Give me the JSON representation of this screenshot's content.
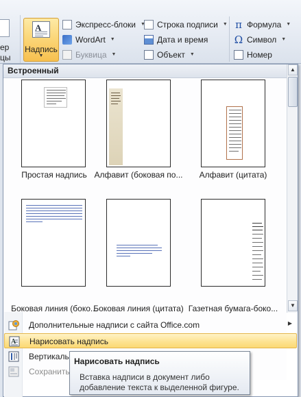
{
  "ribbon": {
    "left_partial_1": "ер",
    "left_partial_2": "цы",
    "text_box_button": "Надпись",
    "quick_parts": "Экспресс-блоки",
    "wordart": "WordArt",
    "drop_cap": "Буквица",
    "signature_line": "Строка подписи",
    "date_time": "Дата и время",
    "object": "Объект",
    "equation": "Формула",
    "symbol": "Символ",
    "number": "Номер"
  },
  "gallery": {
    "section_title": "Встроенный",
    "items": [
      {
        "label": "Простая надпись"
      },
      {
        "label": "Алфавит (боковая по..."
      },
      {
        "label": "Алфавит (цитата)"
      },
      {
        "label": "Боковая линия (боко..."
      },
      {
        "label": "Боковая линия (цитата)"
      },
      {
        "label": "Газетная бумага-боко..."
      }
    ]
  },
  "menu": {
    "more_from_office": "Дополнительные надписи с сайта Office.com",
    "draw_text_box": "Нарисовать надпись",
    "vertical_partial": "Вертикальн",
    "save_partial": "Сохранить"
  },
  "tooltip": {
    "title": "Нарисовать надпись",
    "body": "Вставка надписи в документ либо добавление текста к выделенной фигуре."
  },
  "colors": {
    "highlight": "#fde28f",
    "accent_blue": "#1f4da3",
    "alphabet_sidebar": "#e7dfc9",
    "alphabet_quote_border": "#b0714b"
  }
}
